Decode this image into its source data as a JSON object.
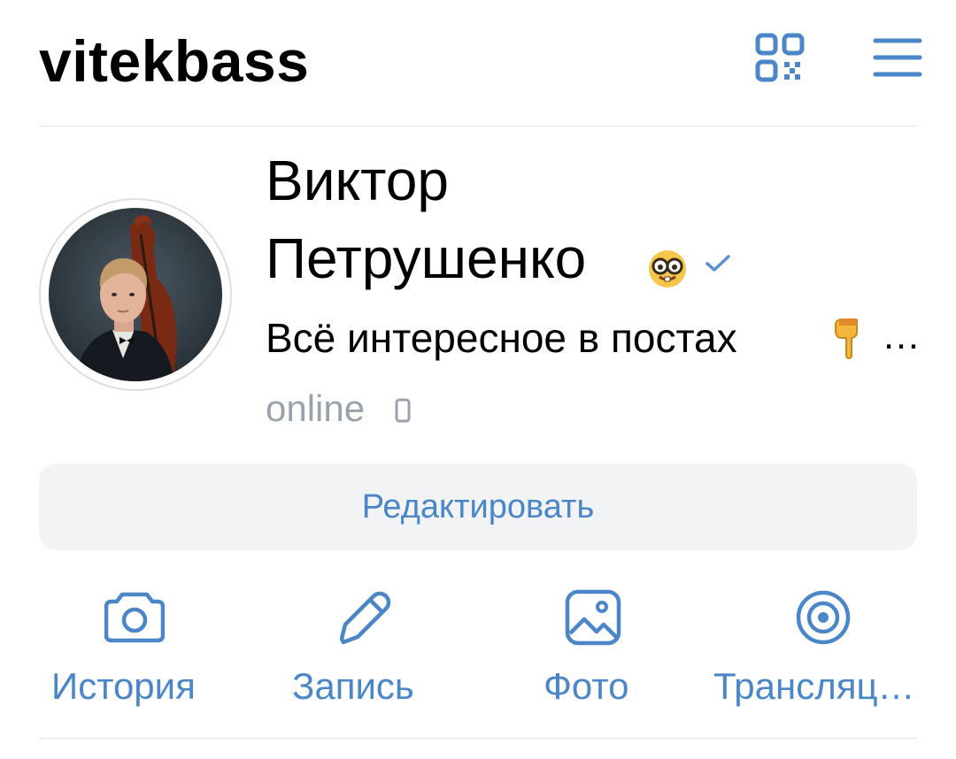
{
  "header": {
    "username": "vitekbass",
    "qr_icon": "qr-code-icon",
    "menu_icon": "hamburger-menu-icon"
  },
  "profile": {
    "first_name": "Виктор",
    "last_name": "Петрушенко",
    "name_emoji": "nerd-face-emoji",
    "verified_icon": "verified-check-icon",
    "status": "Всё интересное в постах",
    "status_emoji": "backhand-index-pointing-down-emoji",
    "status_more": "…",
    "online": "online",
    "online_device_icon": "mobile-phone-icon"
  },
  "edit_button": {
    "label": "Редактировать"
  },
  "actions": [
    {
      "label": "История",
      "icon": "camera-icon"
    },
    {
      "label": "Запись",
      "icon": "pencil-icon"
    },
    {
      "label": "Фото",
      "icon": "image-icon"
    },
    {
      "label": "Трансляц…",
      "icon": "broadcast-icon"
    }
  ],
  "colors": {
    "accent": "#4a86c8",
    "muted": "#99a2ad",
    "button_bg": "#f2f3f5",
    "divider": "#e1e3e6"
  }
}
